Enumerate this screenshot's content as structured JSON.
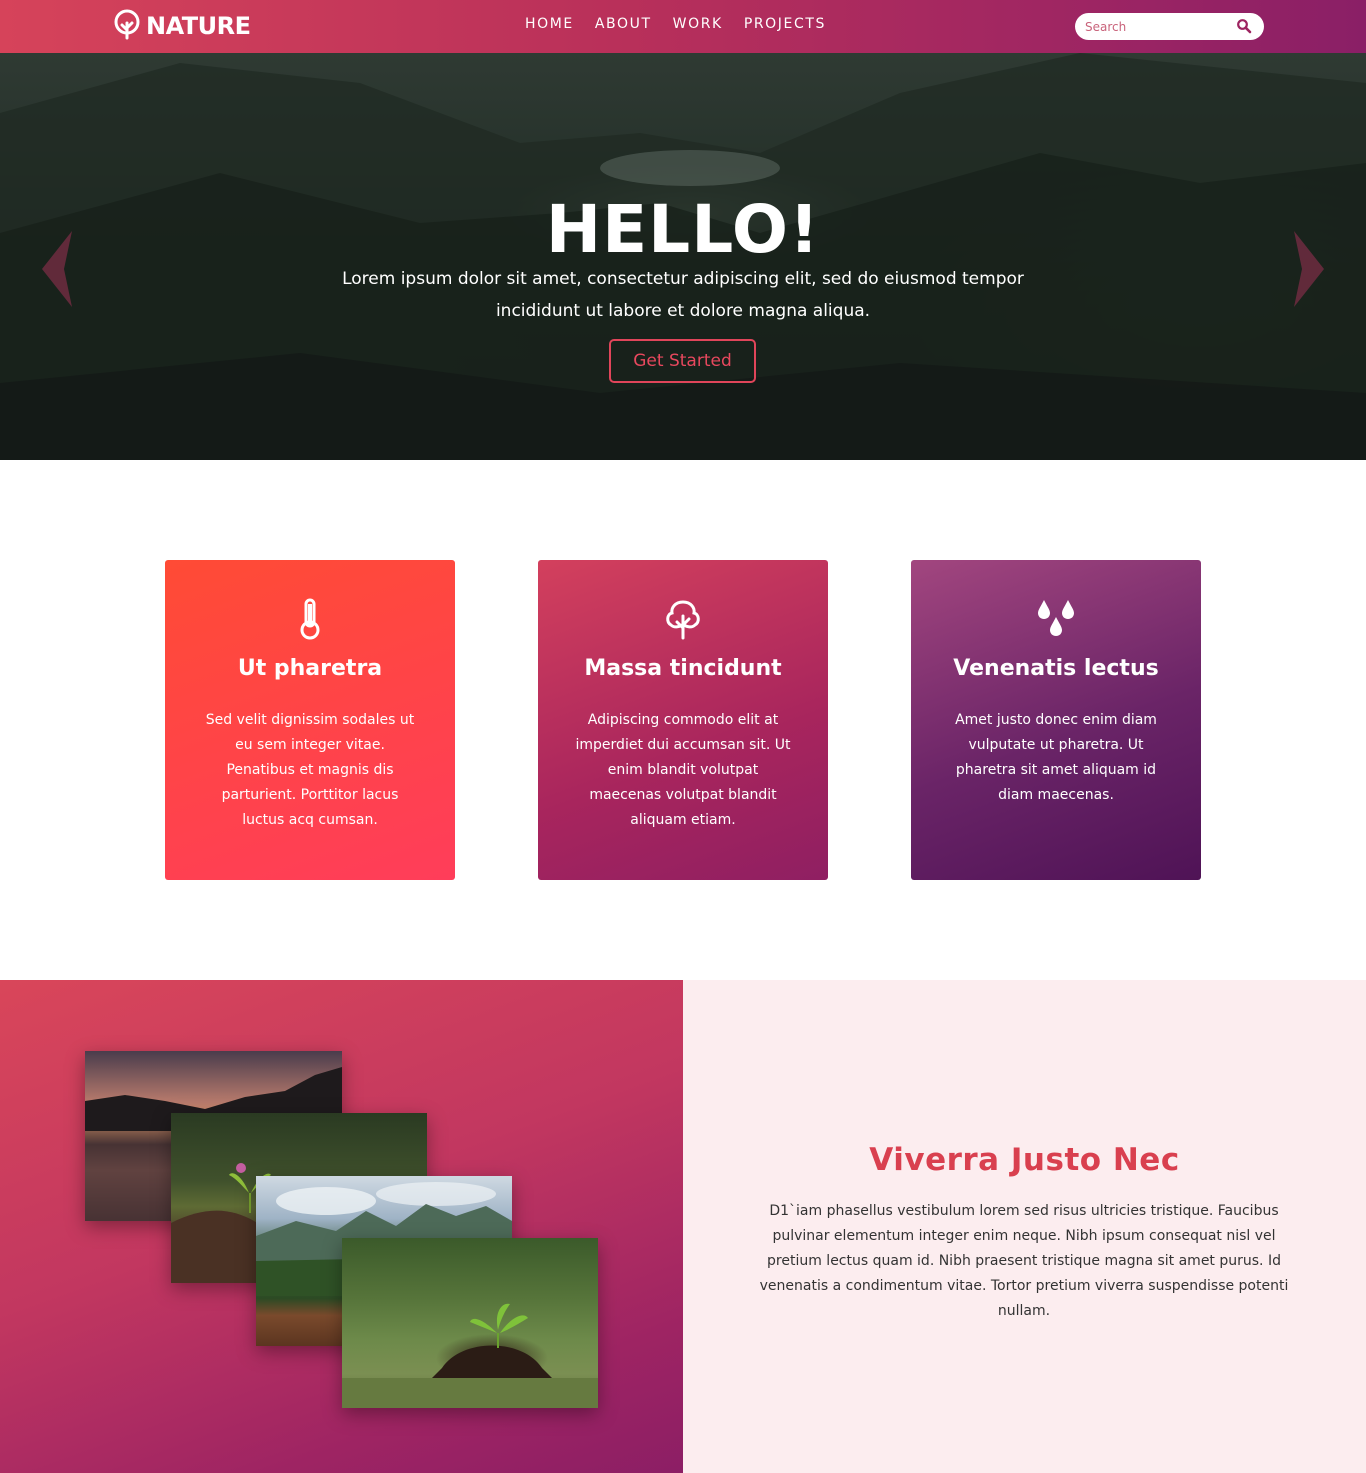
{
  "navbar": {
    "logo_text": "NATURE",
    "links": [
      "HOME",
      "ABOUT",
      "WORK",
      "PROJECTS"
    ],
    "search_placeholder": "Search"
  },
  "hero": {
    "title": "HELLO!",
    "subtitle": "Lorem ipsum dolor sit amet, consectetur adipiscing elit, sed do eiusmod tempor incididunt ut labore et dolore magna aliqua.",
    "button_label": "Get Started"
  },
  "features": [
    {
      "icon": "thermometer-icon",
      "title": "Ut pharetra",
      "text": "Sed velit dignissim sodales ut eu sem integer vitae. Penatibus et magnis dis parturient. Porttitor lacus luctus acq cumsan."
    },
    {
      "icon": "tree-icon",
      "title": "Massa tincidunt",
      "text": "Adipiscing commodo elit at imperdiet dui accumsan sit. Ut enim blandit volutpat maecenas volutpat blandit aliquam etiam."
    },
    {
      "icon": "water-drops-icon",
      "title": "Venenatis lectus",
      "text": "Amet justo donec enim diam vulputate ut pharetra. Ut pharetra sit amet aliquam id diam maecenas."
    }
  ],
  "about": {
    "title": "Viverra Justo Nec",
    "text": "D1`iam phasellus vestibulum lorem sed risus ultricies tristique. Faucibus pulvinar elementum integer enim neque. Nibh ipsum consequat nisl vel pretium lectus quam id. Nibh praesent tristique magna sit amet purus. Id venenatis a condimentum vitae. Tortor pretium viverra suspendisse potenti nullam."
  },
  "colors": {
    "accent": "#e0455a",
    "nav_start": "#d6435a",
    "nav_end": "#8a1f66",
    "about_bg": "#fcedef"
  }
}
